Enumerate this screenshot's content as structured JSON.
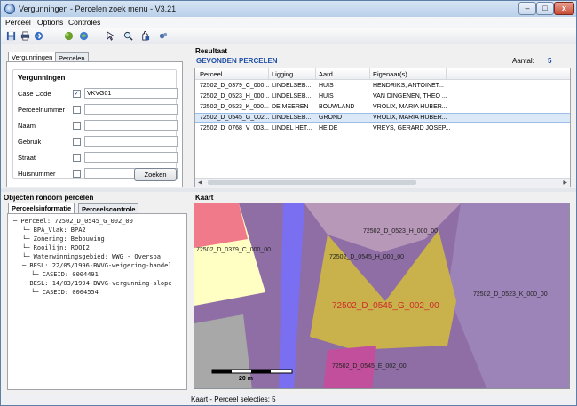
{
  "window": {
    "title": "Vergunningen - Percelen zoek menu - V3.21",
    "min_label": "–",
    "max_label": "□",
    "close_label": "x"
  },
  "menu": [
    "Perceel",
    "Options",
    "Controles"
  ],
  "toolbar_icons": [
    "save-icon",
    "print-icon",
    "export-icon",
    "globe-green-icon",
    "globe-blue-icon",
    "select-arrow-icon",
    "zoom-icon",
    "pan-icon",
    "settings-icon"
  ],
  "search": {
    "tabs": [
      "Vergunningen",
      "Percelen"
    ],
    "group_title": "Vergunningen",
    "fields": [
      {
        "label": "Case Code",
        "checked": true,
        "value": "VKVG01"
      },
      {
        "label": "Perceelnummer",
        "checked": false,
        "value": ""
      },
      {
        "label": "Naam",
        "checked": false,
        "value": ""
      },
      {
        "label": "Gebruik",
        "checked": false,
        "value": ""
      },
      {
        "label": "Straat",
        "checked": false,
        "value": ""
      },
      {
        "label": "Huisnummer",
        "checked": false,
        "value": ""
      }
    ],
    "search_button": "Zoeken"
  },
  "result": {
    "pane_title": "Resultaat",
    "heading": "GEVONDEN PERCELEN",
    "count_label": "Aantal:",
    "count": "5",
    "columns": [
      "Perceel",
      "Ligging",
      "Aard",
      "Eigenaar(s)"
    ],
    "rows": [
      [
        "72502_D_0379_C_000...",
        "LINDELSEB...",
        "HUIS",
        "HENDRIKS, ANTOINET..."
      ],
      [
        "72502_D_0523_H_000...",
        "LINDELSEB...",
        "HUIS",
        "VAN DINGENEN, THEO ..."
      ],
      [
        "72502_D_0523_K_000...",
        "DE MEEREN",
        "BOUWLAND",
        "VROLIX, MARIA HUBER..."
      ],
      [
        "72502_D_0545_G_002...",
        "LINDELSEB...",
        "GROND",
        "VROLIX, MARIA HUBER..."
      ],
      [
        "72502_D_0768_V_003...",
        "LINDEL HET...",
        "HEIDE",
        "VREYS, GERARD JOSEP..."
      ]
    ],
    "selected_row": 3
  },
  "objects": {
    "pane_title": "Objecten rondom percelen",
    "tabs": [
      "Perceelsinformatie",
      "Perceelscontrole"
    ],
    "tree": [
      "─ Perceel: 72502_D_0545_G_002_00",
      "└─ BPA_Vlak: BPA2",
      "└─ Zonering: Bebouwing",
      "└─ Rooilijn: ROOI2",
      "└─ Waterwinningsgebied: WWG - Overspa",
      "─ BESL: 22/05/1996-BWVG-weigering-handel",
      "└─ CASEID: 0004491",
      "─ BESL: 14/03/1994-BWVG-vergunning-slope",
      "└─ CASEID: 0004554"
    ]
  },
  "map": {
    "pane_title": "Kaart",
    "labels": [
      "72502_D_0379_C_000_00",
      "72502_D_0523_H_000_00",
      "72502_D_0545_H_000_00",
      "72502_D_0545_G_002_00",
      "72502_D_0523_K_000_00",
      "72502_D_0545_E_002_00"
    ],
    "scale_label": "20 m"
  },
  "status": {
    "text": "Kaart - Perceel selecties: 5"
  }
}
